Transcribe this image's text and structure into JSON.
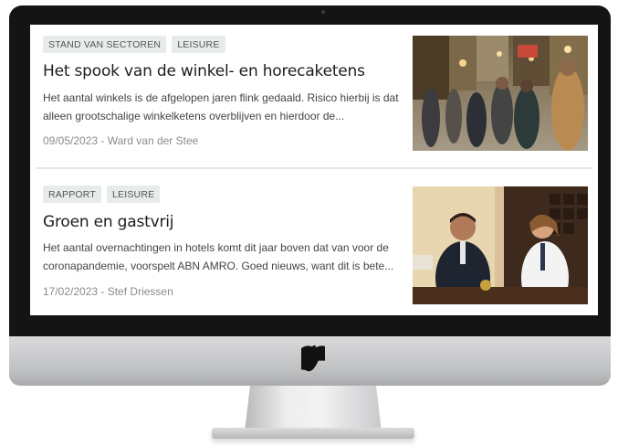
{
  "articles": [
    {
      "tags": [
        "STAND VAN SECTOREN",
        "LEISURE"
      ],
      "title": "Het spook van de winkel- en horecaketens",
      "excerpt": "Het aantal winkels is de afgelopen jaren flink gedaald. Risico hierbij is dat alleen grootschalige winkelketens overblijven en hierdoor de...",
      "meta": "09/05/2023 - Ward van der Stee",
      "image": "shopping-street-crowd-photo"
    },
    {
      "tags": [
        "RAPPORT",
        "LEISURE"
      ],
      "title": "Groen en gastvrij",
      "excerpt": "Het aantal overnachtingen in hotels komt dit jaar boven dat van voor de coronapandemie, voorspelt ABN AMRO. Goed nieuws, want dit is bete...",
      "meta": "17/02/2023 - Stef Driessen",
      "image": "hotel-reception-photo"
    }
  ],
  "device": {
    "logo": "apple-logo"
  }
}
